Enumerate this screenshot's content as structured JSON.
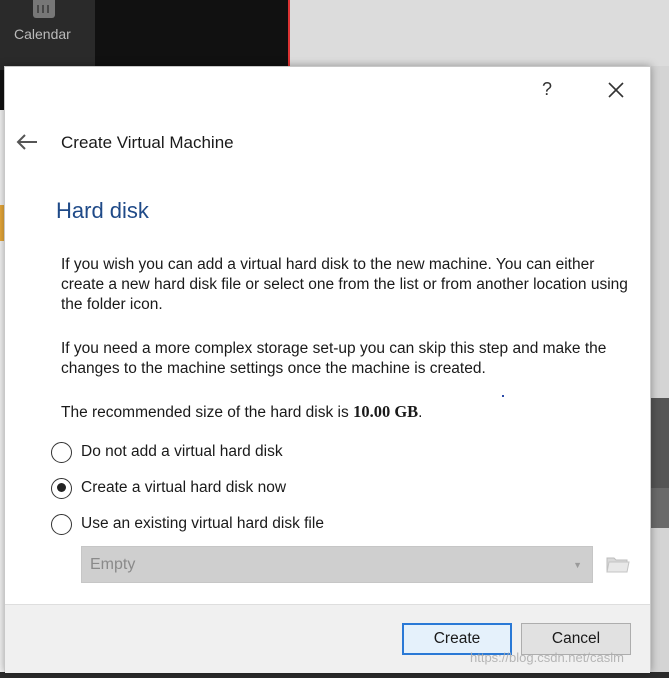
{
  "background": {
    "taskbar_label": "Calendar"
  },
  "dialog": {
    "help_label": "?",
    "page_title": "Create Virtual Machine",
    "section_title": "Hard disk",
    "paragraph1": "If you wish you can add a virtual hard disk to the new machine. You can either create a new hard disk file or select one from the list or from another location using the folder icon.",
    "paragraph2": "If you need a more complex storage set-up you can skip this step and make the changes to the machine settings once the machine is created.",
    "recommended_prefix": "The recommended size of the hard disk is ",
    "recommended_size": "10.00 GB",
    "recommended_suffix": ".",
    "options": [
      {
        "label": "Do not add a virtual hard disk",
        "checked": false
      },
      {
        "label": "Create a virtual hard disk now",
        "checked": true
      },
      {
        "label": "Use an existing virtual hard disk file",
        "checked": false
      }
    ],
    "disk_select": {
      "value": "Empty",
      "enabled": false
    },
    "buttons": {
      "create": "Create",
      "cancel": "Cancel"
    }
  },
  "watermark": "https://blog.csdn.net/caslm",
  "colors": {
    "section_title": "#1f4a88",
    "default_button_border": "#2a79d6"
  }
}
